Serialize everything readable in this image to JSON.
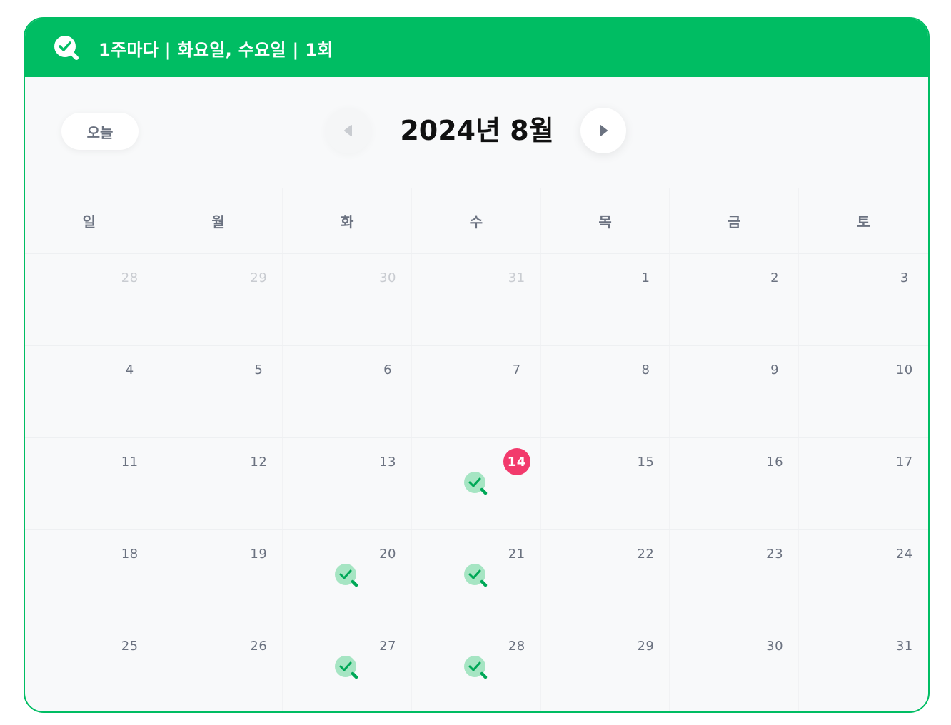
{
  "header": {
    "title": "1주마다 | 화요일, 수요일 | 1회",
    "icon": "check-magnifier-icon",
    "color": "#00bd63"
  },
  "nav": {
    "today_label": "오늘",
    "month_title": "2024년 8월",
    "prev_icon": "chevron-left-icon",
    "next_icon": "chevron-right-icon"
  },
  "weekdays": [
    "일",
    "월",
    "화",
    "수",
    "목",
    "금",
    "토"
  ],
  "weeks": [
    [
      {
        "day": "28",
        "other": true
      },
      {
        "day": "29",
        "other": true
      },
      {
        "day": "30",
        "other": true
      },
      {
        "day": "31",
        "other": true
      },
      {
        "day": "1"
      },
      {
        "day": "2"
      },
      {
        "day": "3"
      }
    ],
    [
      {
        "day": "4"
      },
      {
        "day": "5"
      },
      {
        "day": "6"
      },
      {
        "day": "7"
      },
      {
        "day": "8"
      },
      {
        "day": "9"
      },
      {
        "day": "10"
      }
    ],
    [
      {
        "day": "11"
      },
      {
        "day": "12"
      },
      {
        "day": "13"
      },
      {
        "day": "14",
        "today": true,
        "event": true
      },
      {
        "day": "15"
      },
      {
        "day": "16"
      },
      {
        "day": "17"
      }
    ],
    [
      {
        "day": "18"
      },
      {
        "day": "19"
      },
      {
        "day": "20",
        "event": true
      },
      {
        "day": "21",
        "event": true
      },
      {
        "day": "22"
      },
      {
        "day": "23"
      },
      {
        "day": "24"
      }
    ],
    [
      {
        "day": "25"
      },
      {
        "day": "26"
      },
      {
        "day": "27",
        "event": true
      },
      {
        "day": "28",
        "event": true
      },
      {
        "day": "29"
      },
      {
        "day": "30"
      },
      {
        "day": "31"
      }
    ]
  ],
  "colors": {
    "accent": "#00bd63",
    "today": "#f23a6c",
    "event_bg": "#a6e5c3"
  }
}
